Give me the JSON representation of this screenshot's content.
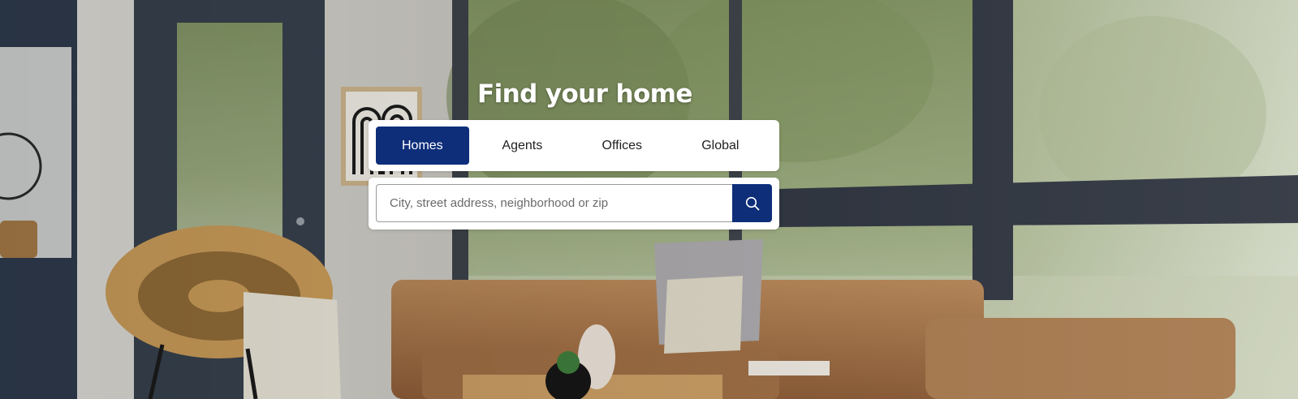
{
  "hero": {
    "title": "Find your home"
  },
  "tabs": [
    {
      "label": "Homes",
      "active": true
    },
    {
      "label": "Agents",
      "active": false
    },
    {
      "label": "Offices",
      "active": false
    },
    {
      "label": "Global",
      "active": false
    }
  ],
  "search": {
    "placeholder": "City, street address, neighborhood or zip",
    "value": "",
    "button_icon": "search-icon"
  },
  "colors": {
    "accent": "#0e2e7a",
    "panel": "#ffffff",
    "title_text": "#ffffff"
  }
}
